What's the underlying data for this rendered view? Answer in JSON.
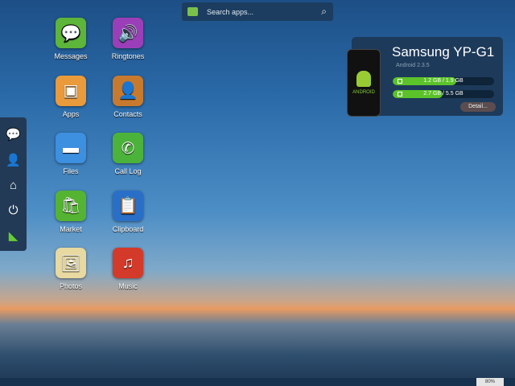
{
  "search": {
    "placeholder": "Search apps..."
  },
  "apps": [
    {
      "label": "Messages",
      "color": "#5db53a",
      "icon": "message-icon",
      "g": "💬"
    },
    {
      "label": "Ringtones",
      "color": "#9b3fb8",
      "icon": "speaker-icon",
      "g": "🔊"
    },
    {
      "label": "Apps",
      "color": "#e99a3a",
      "icon": "box-icon",
      "g": "▣"
    },
    {
      "label": "Contacts",
      "color": "#c77a2e",
      "icon": "contact-icon",
      "g": "👤"
    },
    {
      "label": "Files",
      "color": "#3d8fe0",
      "icon": "folder-icon",
      "g": "▬"
    },
    {
      "label": "Call Log",
      "color": "#4bb33a",
      "icon": "phone-icon",
      "g": "✆"
    },
    {
      "label": "Market",
      "color": "#55b332",
      "icon": "market-icon",
      "g": "🛍"
    },
    {
      "label": "Clipboard",
      "color": "#2a6fc7",
      "icon": "clipboard-icon",
      "g": "📋"
    },
    {
      "label": "Photos",
      "color": "#e8d9a0",
      "icon": "photo-icon",
      "g": "🖼"
    },
    {
      "label": "Music",
      "color": "#d43a2a",
      "icon": "music-icon",
      "g": "♫"
    }
  ],
  "device": {
    "name": "Samsung YP-G1",
    "os": "Android 2.3.5",
    "storage1": "1.2 GB / 1.9 GB",
    "storage1_pct": 63,
    "storage2": "2.7 GB / 5.5 GB",
    "storage2_pct": 49,
    "detail": "Detail...",
    "phone_logo": "android"
  },
  "status": {
    "battery": "80%"
  }
}
